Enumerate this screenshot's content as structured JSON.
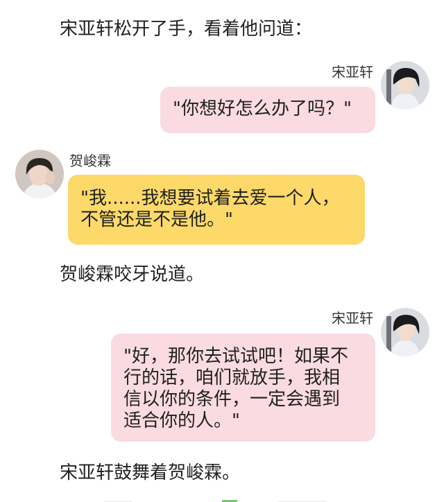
{
  "story": {
    "narration_1": "宋亚轩松开了手，看着他问道：",
    "message_1": {
      "sender": "宋亚轩",
      "text": "\"你想好怎么办了吗？\""
    },
    "message_2": {
      "sender": "贺峻霖",
      "lines": [
        "\"我......我想要试着去爱一个人，",
        "不管还是不是他。\""
      ]
    },
    "narration_2": "贺峻霖咬牙说道。",
    "message_3": {
      "sender": "宋亚轩",
      "lines": [
        "\"好，那你去试试吧！如果不",
        "行的话，咱们就放手，我相",
        "信以你的条件，一定会遇到",
        "适合你的人。\""
      ]
    },
    "narration_3": "宋亚轩鼓舞着贺峻霖。"
  },
  "colors": {
    "pink_bubble": "#fadbe2",
    "yellow_bubble": "#fdd96a"
  }
}
